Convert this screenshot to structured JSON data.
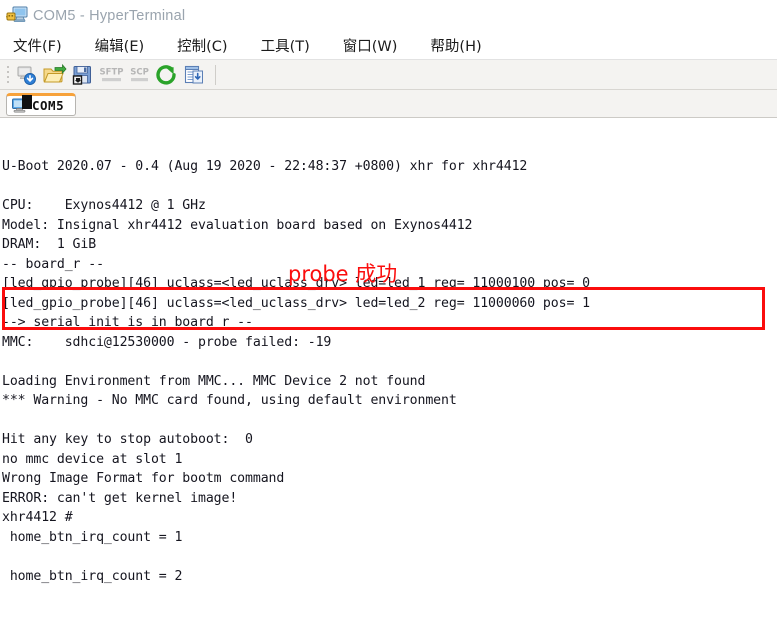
{
  "window": {
    "title": "COM5 - HyperTerminal",
    "icon": "computer-plug-icon"
  },
  "menubar": {
    "items": [
      {
        "label": "文件(F)",
        "name": "menu-file"
      },
      {
        "label": "编辑(E)",
        "name": "menu-edit"
      },
      {
        "label": "控制(C)",
        "name": "menu-control"
      },
      {
        "label": "工具(T)",
        "name": "menu-tools"
      },
      {
        "label": "窗口(W)",
        "name": "menu-window"
      },
      {
        "label": "帮助(H)",
        "name": "menu-help"
      }
    ]
  },
  "toolbar": {
    "buttons": [
      {
        "name": "connect-icon",
        "label": "connect"
      },
      {
        "name": "open-folder-icon",
        "label": "open"
      },
      {
        "name": "save-floppy-icon",
        "label": "save"
      },
      {
        "name": "sftp-icon",
        "label": "SFTP"
      },
      {
        "name": "scp-icon",
        "label": "SCP"
      },
      {
        "name": "reconnect-icon",
        "label": "reconnect"
      },
      {
        "name": "log-icon",
        "label": "log"
      }
    ]
  },
  "tabs": [
    {
      "label": "COM5",
      "name": "tab-com5",
      "active": true
    }
  ],
  "terminal": {
    "lines": [
      "",
      "",
      "U-Boot 2020.07 - 0.4 (Aug 19 2020 - 22:48:37 +0800) xhr for xhr4412",
      "",
      "CPU:    Exynos4412 @ 1 GHz",
      "Model: Insignal xhr4412 evaluation board based on Exynos4412",
      "DRAM:  1 GiB",
      "-- board_r --",
      "[led_gpio_probe][46] uclass=<led_uclass_drv> led=led_1 reg= 11000100 pos= 0",
      "[led_gpio_probe][46] uclass=<led_uclass_drv> led=led_2 reg= 11000060 pos= 1",
      "--> serial_init is in board_r --",
      "MMC:    sdhci@12530000 - probe failed: -19",
      "",
      "Loading Environment from MMC... MMC Device 2 not found",
      "*** Warning - No MMC card found, using default environment",
      "",
      "Hit any key to stop autoboot:  0",
      "no mmc device at slot 1",
      "Wrong Image Format for bootm command",
      "ERROR: can't get kernel image!",
      "xhr4412 #",
      " home_btn_irq_count = 1",
      "",
      " home_btn_irq_count = 2"
    ]
  },
  "annotations": {
    "probe_note": "probe 成功",
    "highlight_color": "#fb0d0d"
  }
}
